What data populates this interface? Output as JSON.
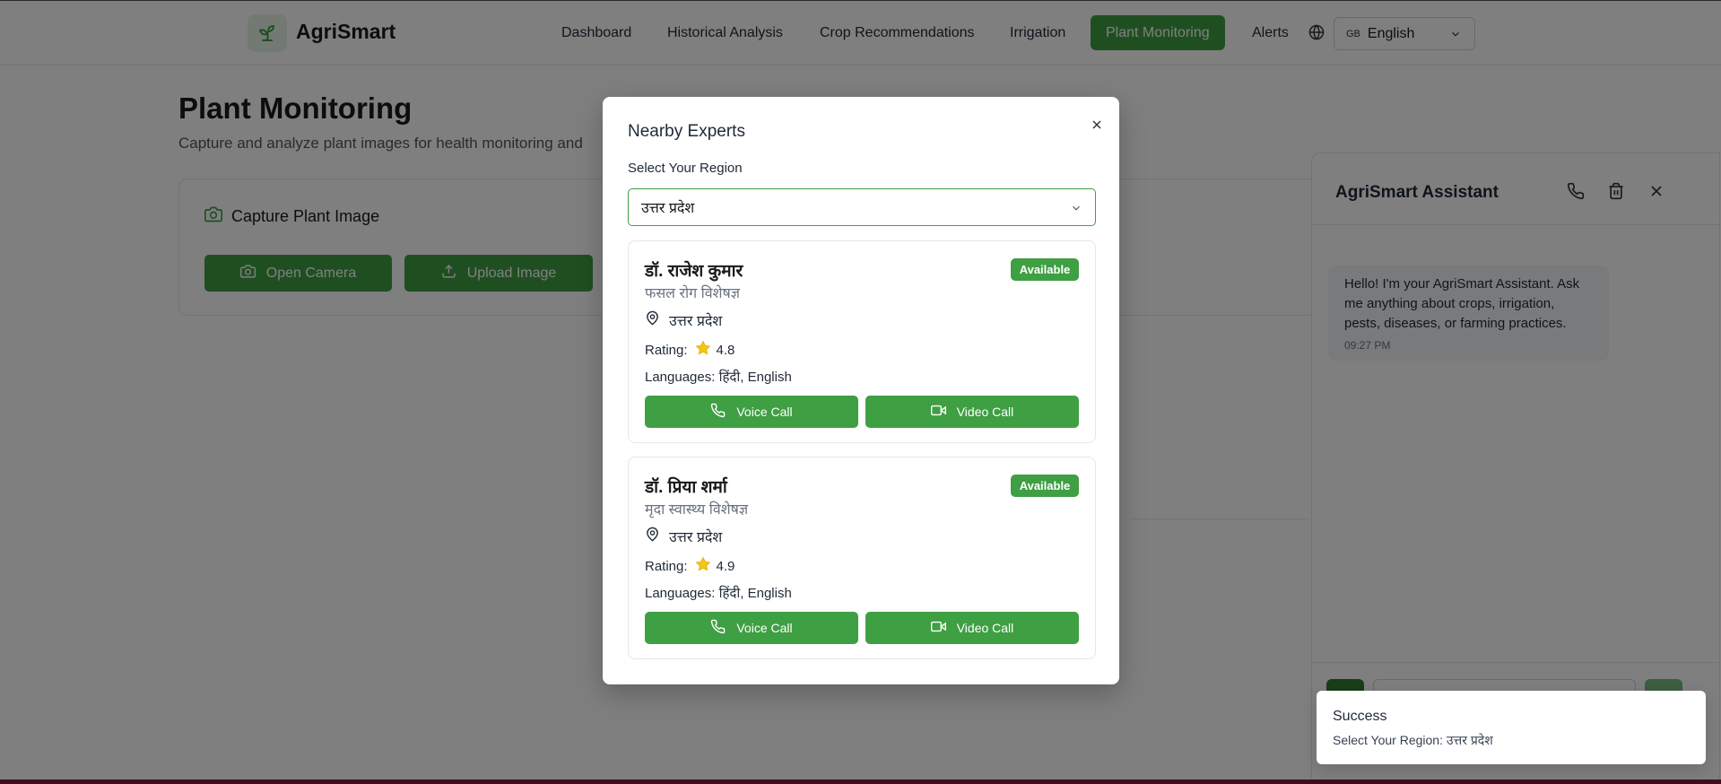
{
  "app": {
    "brand": "AgriSmart",
    "nav": [
      "Dashboard",
      "Historical Analysis",
      "Crop Recommendations",
      "Irrigation",
      "Plant Monitoring",
      "Alerts"
    ],
    "active_nav": "Plant Monitoring",
    "language": {
      "flag": "GB",
      "value": "English"
    }
  },
  "page": {
    "title": "Plant Monitoring",
    "subtitle": "Capture and analyze plant images for health monitoring and",
    "capture": {
      "title": "Capture Plant Image",
      "open_camera": "Open Camera",
      "upload_image": "Upload Image"
    }
  },
  "assistant": {
    "title": "AgriSmart Assistant",
    "message": "Hello! I'm your AgriSmart Assistant. Ask me anything about crops, irrigation, pests, diseases, or farming practices.",
    "time": "09:27 PM"
  },
  "modal": {
    "title": "Nearby Experts",
    "region_label": "Select Your Region",
    "region_value": "उत्तर प्रदेश",
    "experts": [
      {
        "name": "डॉ. राजेश कुमार",
        "specialty": "फसल रोग विशेषज्ञ",
        "status": "Available",
        "location": "उत्तर प्रदेश",
        "rating_label": "Rating:",
        "rating": "4.8",
        "languages_label": "Languages:",
        "languages": "हिंदी, English",
        "voice_call": "Voice Call",
        "video_call": "Video Call"
      },
      {
        "name": "डॉ. प्रिया शर्मा",
        "specialty": "मृदा स्वास्थ्य विशेषज्ञ",
        "status": "Available",
        "location": "उत्तर प्रदेश",
        "rating_label": "Rating:",
        "rating": "4.9",
        "languages_label": "Languages:",
        "languages": "हिंदी, English",
        "voice_call": "Voice Call",
        "video_call": "Video Call"
      }
    ]
  },
  "toast": {
    "title": "Success",
    "description": "Select Your Region: उत्तर प्रदेश"
  },
  "colors": {
    "primary": "#3f9f43",
    "overlay": "rgba(0,0,0,0.5)",
    "star": "#f5c518"
  }
}
